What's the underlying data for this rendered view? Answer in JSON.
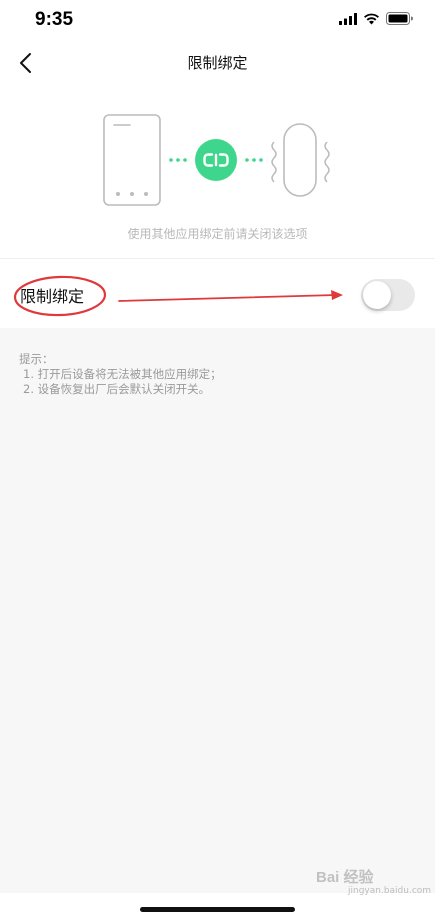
{
  "status_bar": {
    "time": "9:35",
    "icons": [
      "signal-icon",
      "wifi-icon",
      "battery-icon"
    ]
  },
  "nav": {
    "back_icon": "chevron-left-icon",
    "title": "限制绑定"
  },
  "illustration": {
    "caption": "使用其他应用绑定前请关闭该选项",
    "icons": [
      "phone-icon",
      "link-icon",
      "band-icon"
    ],
    "link_color": "#3dd68c"
  },
  "setting": {
    "label": "限制绑定",
    "toggle_on": false
  },
  "tips": {
    "heading": "提示：",
    "items": [
      "1. 打开后设备将无法被其他应用绑定；",
      "2. 设备恢复出厂后会默认关闭开关。"
    ]
  },
  "annotation": {
    "color": "#e0393b"
  },
  "watermark": {
    "text": "Bai 经验",
    "sub": "jingyan.baidu.com"
  }
}
